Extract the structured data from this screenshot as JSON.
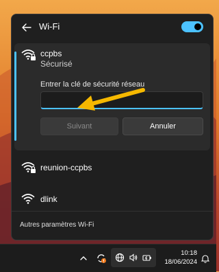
{
  "wifi_panel": {
    "title": "Wi-Fi",
    "wifi_enabled": true,
    "selected_network": {
      "name": "ccpbs",
      "status": "Sécurisé",
      "security_key_label": "Entrer la clé de sécurité réseau",
      "security_key_value": "",
      "next_label": "Suivant",
      "cancel_label": "Annuler"
    },
    "networks": [
      {
        "name": "reunion-ccpbs",
        "secured": true
      },
      {
        "name": "dlink",
        "secured": false
      }
    ],
    "footer_link": "Autres paramètres Wi-Fi"
  },
  "taskbar": {
    "time": "10:18",
    "date": "18/06/2024"
  },
  "colors": {
    "accent": "#4cc2ff",
    "panel_bg": "#1f1f1f",
    "arrow": "#f5b800"
  }
}
